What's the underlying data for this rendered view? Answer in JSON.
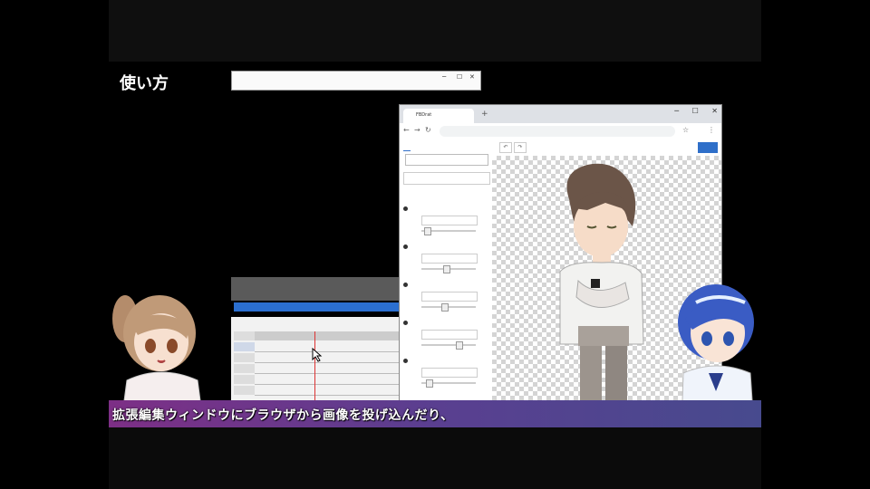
{
  "heading": "使い方",
  "back_window": {
    "title": "",
    "menu": ""
  },
  "browser": {
    "tab_title": "FBDrat",
    "url": "",
    "side_tabs": [
      "",
      ""
    ],
    "side_button": "",
    "side_select": "",
    "section_title": "",
    "params": [
      {
        "label": "",
        "value": "",
        "level": 0.05
      },
      {
        "label": "",
        "value": "",
        "level": 0.45
      },
      {
        "label": "",
        "value": "",
        "level": 0.4
      },
      {
        "label": "",
        "value": "",
        "level": 0.7
      },
      {
        "label": "",
        "value": "",
        "level": 0.1
      }
    ],
    "toolbar": {
      "label1": "",
      "label2": "",
      "label3": "",
      "button": ""
    }
  },
  "subtitle": "拡張編集ウィンドウにブラウザから画像を投げ込んだり、",
  "colors": {
    "subtitle_left": "#7d2f86",
    "subtitle_right": "#474a8e",
    "accent_blue": "#2f6fc9"
  }
}
